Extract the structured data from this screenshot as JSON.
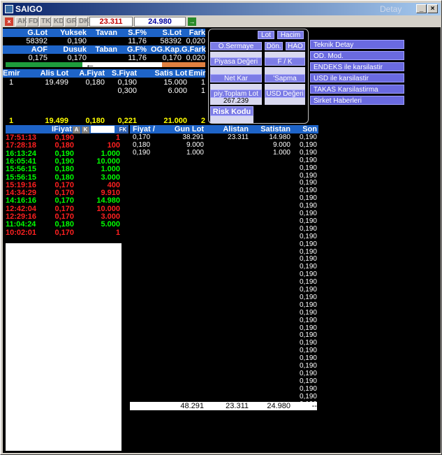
{
  "window": {
    "title": "SAIGO",
    "title_right": "Detay",
    "minimize": "_",
    "maximize": "□",
    "close": "×"
  },
  "toolbar": {
    "close_label": "×",
    "tabs": [
      "AK",
      "FD",
      "TK",
      "KD",
      "GR",
      "DK"
    ],
    "value_left": "23.311",
    "value_right": "24.980",
    "go_label": "→"
  },
  "summary": {
    "headers1": [
      "G.Lot",
      "Yuksek",
      "Tavan",
      "S.F%",
      "S.Lot",
      "Fark"
    ],
    "values1": [
      "58392",
      "0,190",
      "",
      "11,76",
      "58392",
      "0,020"
    ],
    "headers2": [
      "AOF",
      "Dusuk",
      "Taban",
      "G.F%",
      "OG.Kap.",
      "G.Fark"
    ],
    "values2": [
      "0,175",
      "0,170",
      "",
      "11,76",
      "0,170",
      "0,020"
    ],
    "arrow": "←"
  },
  "orderbook": {
    "headers": [
      "Emir",
      "Alis Lot",
      "A.Fiyat",
      "S.Fiyat",
      "Satis Lot",
      "Emir"
    ],
    "rows": [
      [
        "1",
        "19.499",
        "0,180",
        "0,190",
        "15.000",
        "1"
      ],
      [
        "",
        "",
        "",
        "0,300",
        "6.000",
        "1"
      ]
    ],
    "totals": [
      "1",
      "19.499",
      "0,180",
      "0,221",
      "21.000",
      "2"
    ]
  },
  "panel": {
    "lot": "Lot",
    "hacim": "Hacim",
    "o_sermaye": "O.Sermaye",
    "don": "Dön.",
    "hao": "HAO",
    "piyasa_degeri": "Piyasa Değeri",
    "fk": "F / K",
    "net_kar": "Net Kar",
    "sapma": "'Sapma",
    "piy_toplam_lot": "piy.Toplam Lot",
    "piy_toplam_val": "267.239",
    "usd_degeri": "USD Değeri",
    "risk_kodu": "Risk Kodu"
  },
  "menu": [
    "Teknik Detay",
    "OD. Mod.",
    "ENDEKS ile karsilastir",
    "USD ile karsilastir",
    "TAKAS Karsilastirma",
    "Sirket Haberleri"
  ],
  "trades": {
    "header_price": "IFiyat",
    "btn_a": "A",
    "btn_k": "K",
    "btn_fk": "FK",
    "rows": [
      {
        "time": "17:51:13",
        "price": "0,190",
        "lot": "1",
        "color": "red"
      },
      {
        "time": "17:28:18",
        "price": "0,180",
        "lot": "100",
        "color": "red"
      },
      {
        "time": "16:13:24",
        "price": "0,190",
        "lot": "1.000",
        "color": "green"
      },
      {
        "time": "16:05:41",
        "price": "0,190",
        "lot": "10.000",
        "color": "green"
      },
      {
        "time": "15:56:15",
        "price": "0,180",
        "lot": "1.000",
        "color": "green"
      },
      {
        "time": "15:56:15",
        "price": "0,180",
        "lot": "3.000",
        "color": "green"
      },
      {
        "time": "15:19:16",
        "price": "0,170",
        "lot": "400",
        "color": "red"
      },
      {
        "time": "14:34:29",
        "price": "0,170",
        "lot": "9.910",
        "color": "red"
      },
      {
        "time": "14:16:16",
        "price": "0,170",
        "lot": "14.980",
        "color": "green"
      },
      {
        "time": "12:42:04",
        "price": "0,170",
        "lot": "10.000",
        "color": "red"
      },
      {
        "time": "12:29:16",
        "price": "0,170",
        "lot": "3.000",
        "color": "red"
      },
      {
        "time": "11:04:24",
        "price": "0,180",
        "lot": "5.000",
        "color": "green"
      },
      {
        "time": "10:02:01",
        "price": "0,170",
        "lot": "1",
        "color": "red"
      }
    ]
  },
  "depth": {
    "headers": [
      "Fiyat /",
      "Gun Lot",
      "Alistan",
      "Satistan",
      "Son"
    ],
    "rows": [
      [
        "0,170",
        "38.291",
        "23.311",
        "14.980"
      ],
      [
        "0,180",
        "9.000",
        "",
        "9.000"
      ],
      [
        "0,190",
        "1.000",
        "",
        "1.000"
      ]
    ],
    "son_value": "0,190",
    "son_count": 36,
    "totals": [
      "48.291",
      "23.311",
      "24.980",
      "--"
    ]
  }
}
